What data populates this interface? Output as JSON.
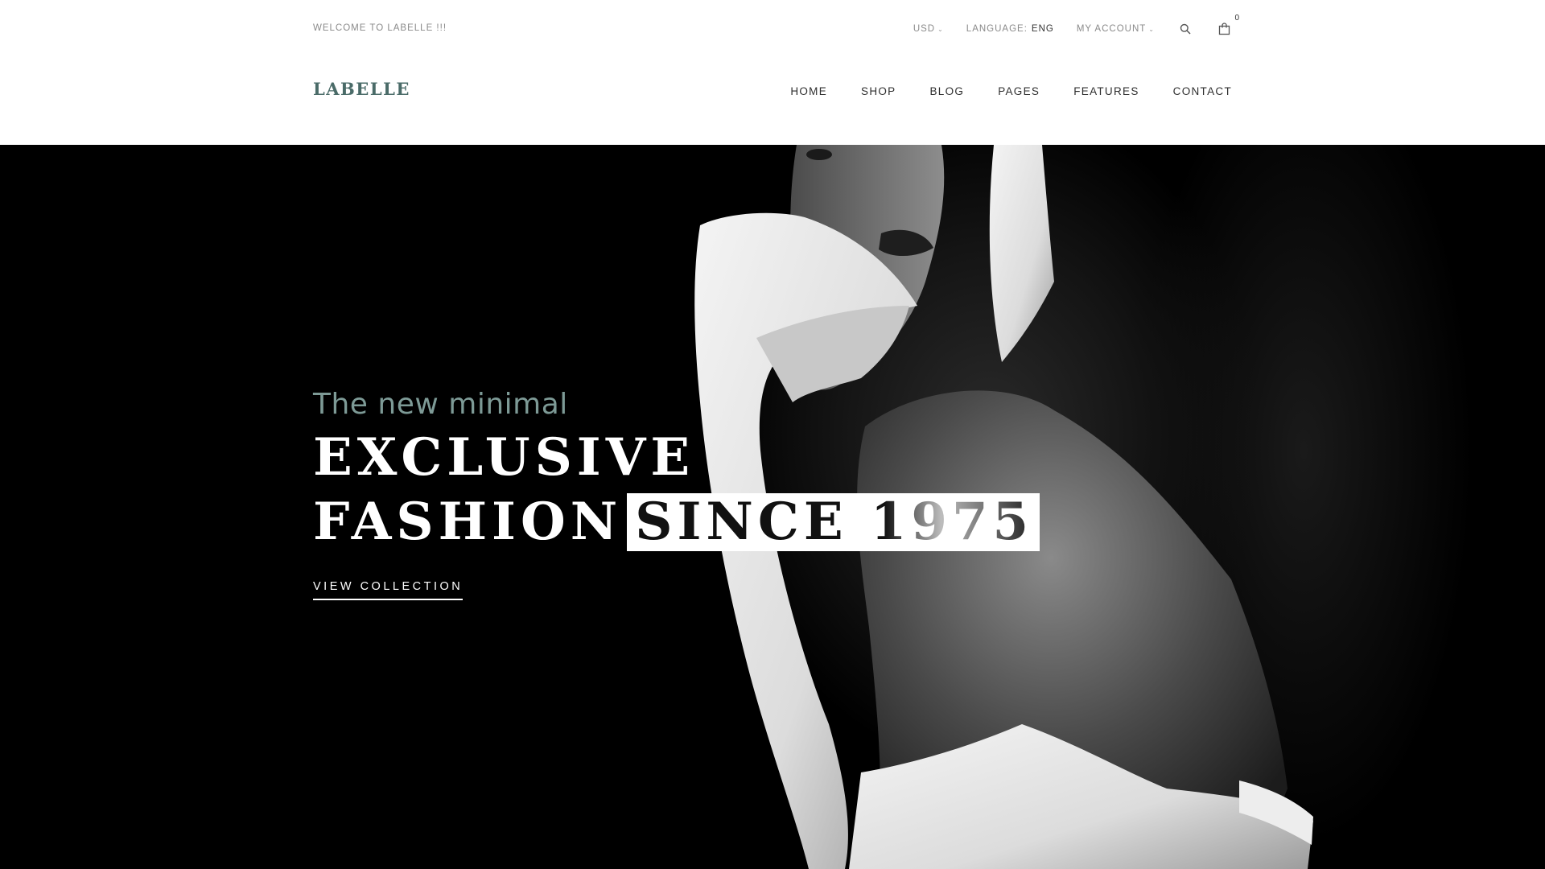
{
  "topbar": {
    "welcome": "WELCOME TO LABELLE !!!",
    "currency": "USD",
    "language_label": "LANGUAGE:",
    "language_value": "ENG",
    "account": "MY ACCOUNT",
    "cart_count": "0"
  },
  "header": {
    "logo": "LABELLE",
    "nav": [
      "HOME",
      "SHOP",
      "BLOG",
      "PAGES",
      "FEATURES",
      "CONTACT"
    ]
  },
  "hero": {
    "tagline": "The new minimal",
    "headline_line1": "EXCLUSIVE",
    "headline_line2": "FASHION",
    "highlight_start": "SINC",
    "highlight_end": "E 1975",
    "cta": "VIEW COLLECTION"
  },
  "colors": {
    "brand": "#4a6b68",
    "tagline": "#7d9a96",
    "hero_bg": "#000000"
  },
  "icons": {
    "search": "search-icon",
    "cart": "shopping-bag-icon",
    "caret": "chevron-down-icon"
  }
}
